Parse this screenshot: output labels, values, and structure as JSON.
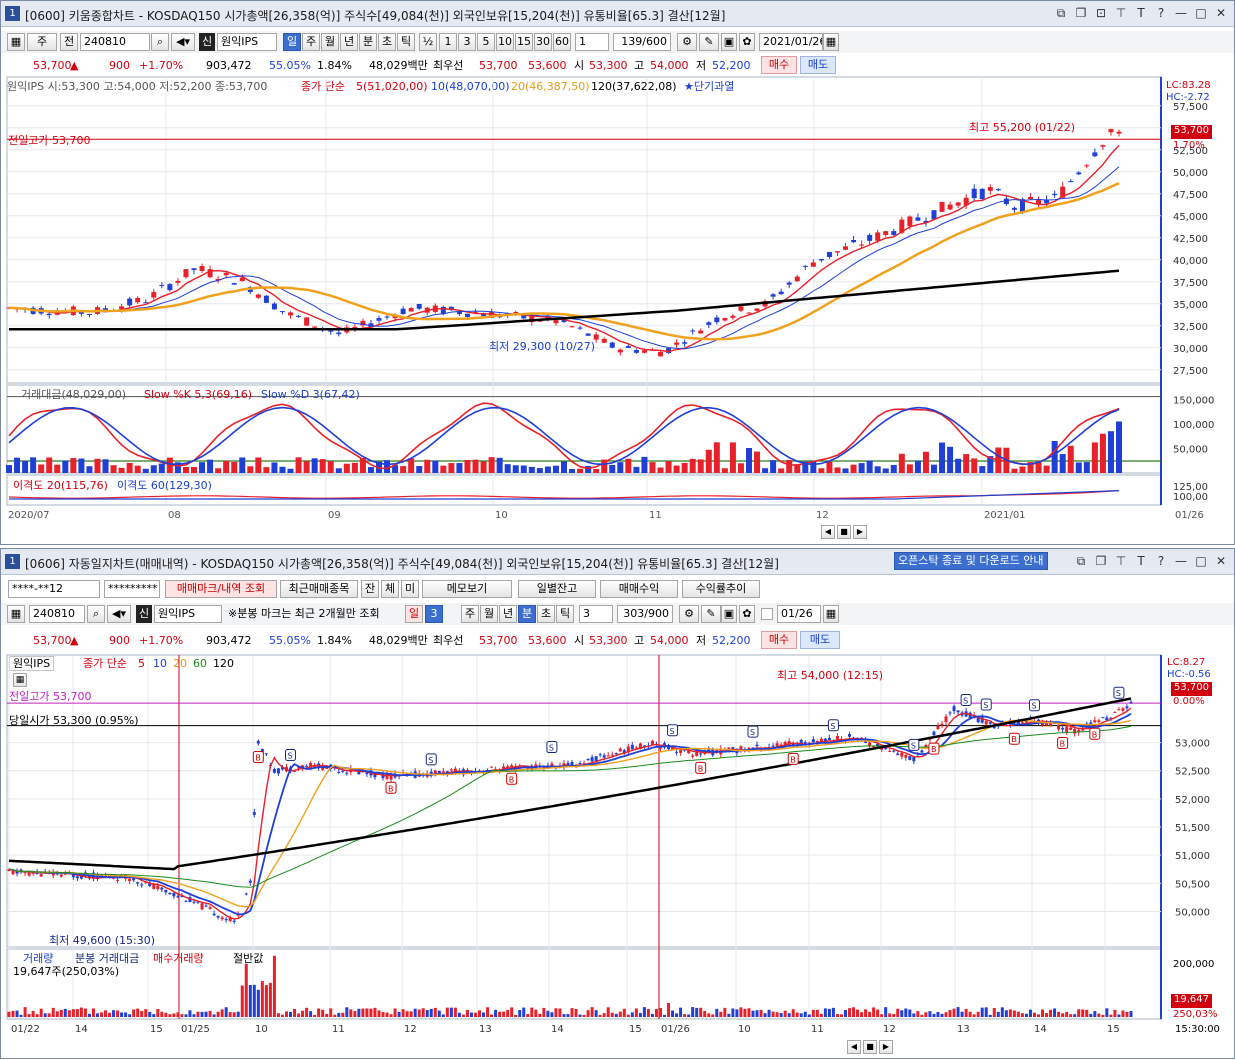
{
  "top": {
    "title": {
      "num": "1",
      "text": "[0600] 키움종합차트 - KOSDAQ150 시가총액[26,358(억)] 주식수[49,084(천)] 외국인보유[15,204(천)] 유통비율[65.3] 결산[12월]"
    },
    "toolbar": {
      "ju": "주",
      "jeon": "전",
      "code": "240810",
      "sin": "신",
      "name": "원익IPS",
      "periods": [
        "일",
        "주",
        "월",
        "년",
        "분",
        "초",
        "틱"
      ],
      "half": "½",
      "nums": [
        "1",
        "3",
        "5",
        "10",
        "15",
        "30",
        "60"
      ],
      "count_sel": "1",
      "count": "139/600",
      "date": "2021/01/26"
    },
    "quote": {
      "price": "53,700",
      "arrow": "▲",
      "change": "900",
      "pct": "+1.70%",
      "volume": "903,472",
      "ratio1": "55.05%",
      "ratio2": "1.84%",
      "amount": "48,029백만",
      "best_label": "최우선",
      "ask": "53,700",
      "bid": "53,600",
      "open_l": "시",
      "open": "53,300",
      "high_l": "고",
      "high": "54,000",
      "low_l": "저",
      "low": "52,200",
      "buy": "매수",
      "sell": "매도"
    },
    "legend": {
      "ohlc": "원익IPS 시:53,300 고:54,000 저:52,200 종:53,700",
      "ma_prefix": "종가 단순",
      "ma5": "5(51,020,00)",
      "ma10": "10(48,070,00)",
      "ma20": "20(46,387,50)",
      "ma120": "120(37,622,08)",
      "event": "★단기과열"
    },
    "price_axis": {
      "lc": "LC:83.28",
      "hc": "HC:-2.72",
      "current": "53,700",
      "pct": "1.70%",
      "ticks": [
        "57,500",
        "55,000",
        "52,500",
        "50,000",
        "47,500",
        "45,000",
        "42,500",
        "40,000",
        "37,500",
        "35,000",
        "32,500",
        "30,000",
        "27,500"
      ]
    },
    "annotations": {
      "prev_high": "전일고가 53,700",
      "max": "최고 55,200 (01/22)",
      "min": "최저 29,300 (10/27)"
    },
    "sub_legend": {
      "amount": "거래대금(48,029,00)",
      "slowk": "Slow %K 5,3(69,16)",
      "slowd": "Slow %D 3(67,42)"
    },
    "sub_ticks": [
      "150,000",
      "100,000",
      "50,000"
    ],
    "disp_legend": {
      "d20": "이격도 20(115,76)",
      "d60": "이격도 60(129,30)"
    },
    "disp_ticks": [
      "125,00",
      "100,00"
    ],
    "dates": [
      "2020/07",
      "08",
      "09",
      "10",
      "11",
      "12",
      "2021/01"
    ],
    "date_right": "01/26"
  },
  "bottom": {
    "title": {
      "num": "1",
      "text": "[0606] 자동일지차트(매매내역) - KOSDAQ150 시가총액[26,358(억)] 주식수[49,084(천)] 외국인보유[15,204(천)] 유통비율[65.3] 결산[12월]",
      "notice": "오픈스탁 종료 및 다운로드 안내"
    },
    "row1": {
      "account": "****-**12",
      "password": "*********",
      "btn_mark": "매매마크/내역 조회",
      "btn_recent": "최근매매종목",
      "btn_jan": "잔",
      "btn_che": "체",
      "btn_mi": "미",
      "btn_memo": "메모보기",
      "btn_daily": "일별잔고",
      "btn_profit": "매매수익",
      "btn_rate": "수익률추이"
    },
    "row2": {
      "code": "240810",
      "sin": "신",
      "name": "원익IPS",
      "note": "※분봉 마크는 최근 2개월만 조회",
      "periods": [
        "일",
        "3",
        "주",
        "월",
        "년",
        "분",
        "초",
        "틱"
      ],
      "count_sel": "3",
      "count": "303/900",
      "date": "01/26"
    },
    "quote": {
      "price": "53,700",
      "arrow": "▲",
      "change": "900",
      "pct": "+1.70%",
      "volume": "903,472",
      "ratio1": "55.05%",
      "ratio2": "1.84%",
      "amount": "48,029백만",
      "best_label": "최우선",
      "ask": "53,700",
      "bid": "53,600",
      "open_l": "시",
      "open": "53,300",
      "high_l": "고",
      "high": "54,000",
      "low_l": "저",
      "low": "52,200",
      "buy": "매수",
      "sell": "매도"
    },
    "legend": {
      "name": "원익IPS",
      "ma_prefix": "종가 단순",
      "ma5": "5",
      "ma10": "10",
      "ma20": "20",
      "ma60": "60",
      "ma120": "120"
    },
    "price_axis": {
      "lc": "LC:8.27",
      "hc": "HC:-0.56",
      "current": "53,700",
      "pct": "0.00%",
      "ticks": [
        "53,000",
        "52,500",
        "52,000",
        "51,500",
        "51,000",
        "50,500",
        "50,000"
      ]
    },
    "annotations": {
      "prev_high": "전일고가 53,700",
      "open_today": "당일시가 53,300 (0.95%)",
      "max": "최고 54,000 (12:15)",
      "min": "최저 49,600 (15:30)"
    },
    "vol_legend": {
      "vol": "거래량",
      "amt": "분봉 거래대금",
      "buyvol": "매수거래량",
      "half": "절반값",
      "value": "19,647주(250,03%)"
    },
    "vol_ticks": [
      "200,000",
      "19,647",
      "250,03%"
    ],
    "times": [
      "01/22",
      "14",
      "15",
      "01/25",
      "10",
      "11",
      "12",
      "13",
      "14",
      "15",
      "01/26",
      "10",
      "11",
      "12",
      "13",
      "14",
      "15"
    ],
    "time_right": "15:30:00"
  },
  "colors": {
    "up": "#e8202a",
    "down": "#1f3fd6",
    "ma5": "#e8202a",
    "ma10": "#1f3fd6",
    "ma20": "#f0a11e",
    "ma120": "#000000",
    "accent": "#3c6ecf"
  }
}
